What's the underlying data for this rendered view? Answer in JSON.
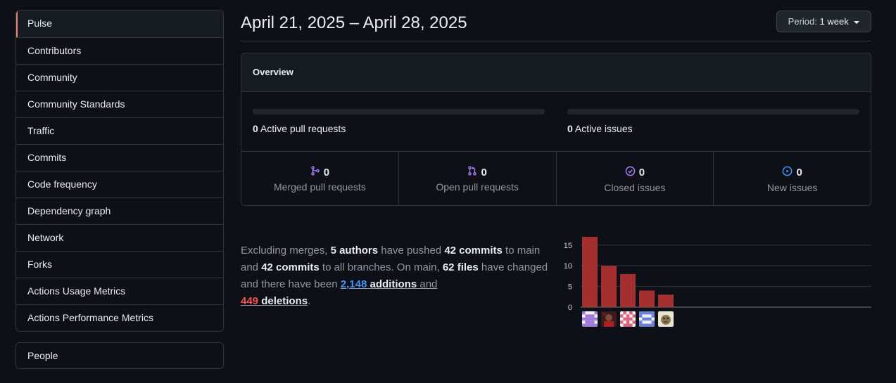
{
  "sidebar": {
    "items": [
      {
        "label": "Pulse",
        "active": true
      },
      {
        "label": "Contributors"
      },
      {
        "label": "Community"
      },
      {
        "label": "Community Standards"
      },
      {
        "label": "Traffic"
      },
      {
        "label": "Commits"
      },
      {
        "label": "Code frequency"
      },
      {
        "label": "Dependency graph"
      },
      {
        "label": "Network"
      },
      {
        "label": "Forks"
      },
      {
        "label": "Actions Usage Metrics"
      },
      {
        "label": "Actions Performance Metrics"
      }
    ],
    "people_label": "People"
  },
  "header": {
    "title": "April 21, 2025 – April 28, 2025",
    "period_prefix": "Period:",
    "period_value": "1 week"
  },
  "overview": {
    "heading": "Overview",
    "active_prs_count": "0",
    "active_prs_label": "Active pull requests",
    "active_issues_count": "0",
    "active_issues_label": "Active issues",
    "stats": [
      {
        "icon": "git-merge-icon",
        "count": "0",
        "label": "Merged pull requests",
        "color": "#ab7df8"
      },
      {
        "icon": "git-pull-request-icon",
        "count": "0",
        "label": "Open pull requests",
        "color": "#ab7df8"
      },
      {
        "icon": "issue-closed-icon",
        "count": "0",
        "label": "Closed issues",
        "color": "#ab7df8"
      },
      {
        "icon": "issue-opened-icon",
        "count": "0",
        "label": "New issues",
        "color": "#4493f8"
      }
    ]
  },
  "summary": {
    "t1": "Excluding merges, ",
    "authors": "5 authors",
    "t2": " have pushed ",
    "commits_main": "42 commits",
    "t3": " to main and ",
    "commits_all": "42 commits",
    "t4": " to all branches. On main, ",
    "files": "62 files",
    "t5": " have changed and there have been ",
    "additions_num": "2,148",
    "additions_word": "additions",
    "t6": " and",
    "deletions_num": "449",
    "deletions_word": "deletions",
    "t7": "."
  },
  "chart_data": {
    "type": "bar",
    "categories": [
      "author 1",
      "author 2",
      "author 3",
      "author 4",
      "author 5"
    ],
    "values": [
      17,
      10,
      8,
      4,
      3
    ],
    "yticks": [
      0,
      5,
      10,
      15
    ],
    "ylim": [
      0,
      17
    ],
    "grid": true,
    "bar_color": "#a3302f"
  },
  "colors": {
    "accent": "#f78166",
    "link": "#4493f8",
    "deletion": "#f85149",
    "purple": "#ab7df8"
  }
}
